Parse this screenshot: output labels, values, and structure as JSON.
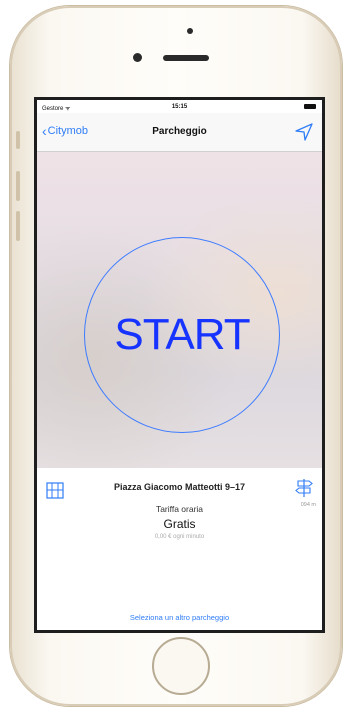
{
  "status_bar": {
    "carrier": "Gestore ᯤ",
    "time": "15:15"
  },
  "nav": {
    "back_label": "Citymob",
    "title": "Parcheggio",
    "location_icon": "location-arrow-icon"
  },
  "hero": {
    "start_label": "START"
  },
  "parking": {
    "address": "Piazza Giacomo Matteotti 9–17",
    "distance": "094 m",
    "rate_label": "Tariffa oraria",
    "rate_value": "Gratis",
    "rate_detail": "0,00 € ogni minuto"
  },
  "footer": {
    "select_other": "Seleziona un altro parcheggio"
  },
  "colors": {
    "accent": "#2f7df6",
    "start_text": "#1633ff",
    "start_ring": "#3d7bff",
    "phone_gold": "#e9e1d1"
  }
}
